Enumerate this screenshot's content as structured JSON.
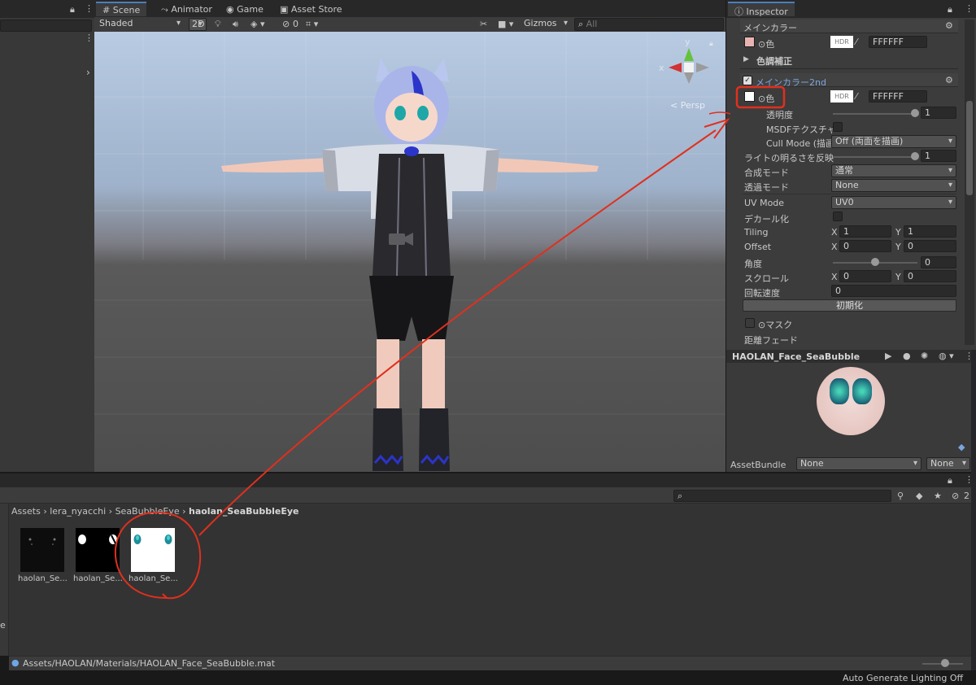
{
  "scene_tabs": {
    "scene": "Scene",
    "animator": "Animator",
    "game": "Game",
    "asset_store": "Asset Store"
  },
  "scene_toolbar": {
    "shading_mode": "Shaded",
    "mode_2d": "2D",
    "hidden_count": "0",
    "gizmos": "Gizmos",
    "search_placeholder": "All"
  },
  "gizmo": {
    "y_label": "y",
    "x_label": "x",
    "projection": "< Persp"
  },
  "inspector": {
    "tab": "Inspector",
    "main_color_header": "メインカラー",
    "main_color_label": "⊙色",
    "main_color_hdr": "HDR",
    "main_color_hex": "FFFFFF",
    "color_adjust": "色調補正",
    "main_color_2nd_header": "メインカラー2nd",
    "color2_label": "⊙色",
    "color2_hdr": "HDR",
    "color2_hex": "FFFFFF",
    "opacity_label": "透明度",
    "opacity_value": "1",
    "msdf_label": "MSDFテクスチャ",
    "cull_label": "Cull Mode (描画",
    "cull_value": "Off (両面を描画)",
    "light_label": "ライトの明るさを反映",
    "light_value": "1",
    "blend_label": "合成モード",
    "blend_value": "通常",
    "transparency_label": "透過モード",
    "transparency_value": "None",
    "uv_label": "UV Mode",
    "uv_value": "UV0",
    "decal_label": "デカール化",
    "tiling_label": "Tiling",
    "tiling_x_label": "X",
    "tiling_x": "1",
    "tiling_y_label": "Y",
    "tiling_y": "1",
    "offset_label": "Offset",
    "offset_x_label": "X",
    "offset_x": "0",
    "offset_y_label": "Y",
    "offset_y": "0",
    "angle_label": "角度",
    "angle_value": "0",
    "scroll_label": "スクロール",
    "scroll_x_label": "X",
    "scroll_x": "0",
    "scroll_y_label": "Y",
    "scroll_y": "0",
    "rotation_speed_label": "回転速度",
    "rotation_speed_value": "0",
    "reset_button": "初期化",
    "mask_label": "⊙マスク",
    "distance_fade_label": "距離フェード"
  },
  "preview": {
    "title": "HAOLAN_Face_SeaBubble",
    "assetbundle_label": "AssetBundle",
    "assetbundle_value": "None",
    "variant_value": "None"
  },
  "project": {
    "breadcrumb": [
      "Assets",
      "lera_nyacchi",
      "SeaBubbleEye",
      "haolan_SeaBubbleEye"
    ],
    "hidden_count": "2",
    "assets": [
      {
        "name": "haolan_Se...",
        "color": "#0d0d0d"
      },
      {
        "name": "haolan_Se...",
        "color": "#000000"
      },
      {
        "name": "haolan_Se...",
        "color": "#ffffff"
      }
    ],
    "left_edge_char": "e",
    "footer_path": "Assets/HAOLAN/Materials/HAOLAN_Face_SeaBubble.mat"
  },
  "status_bar": {
    "text": "Auto Generate Lighting Off"
  },
  "colors": {
    "annotation": "#e0301e",
    "accent": "#4a7ebb"
  }
}
